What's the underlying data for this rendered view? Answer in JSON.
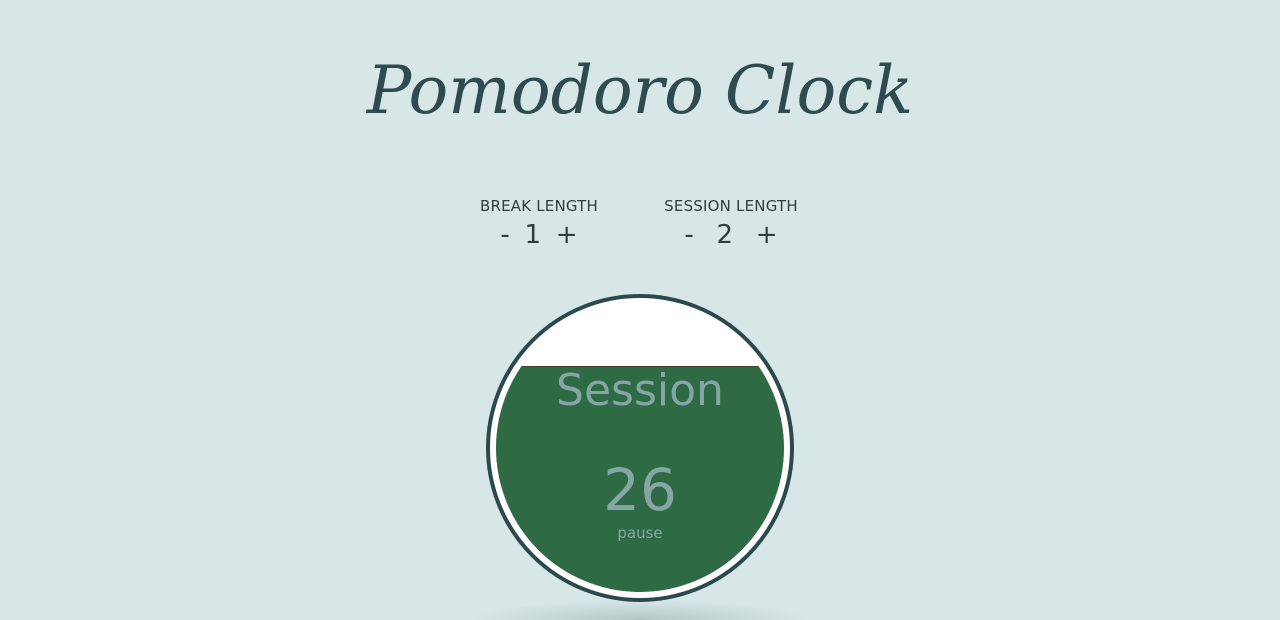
{
  "app": {
    "title": "Pomodoro Clock"
  },
  "break_length": {
    "label": "BREAK LENGTH",
    "decrement": "-",
    "value": "1",
    "increment": "+"
  },
  "session_length": {
    "label": "SESSION LENGTH",
    "decrement": "-",
    "value": "2",
    "increment": "+"
  },
  "clock": {
    "mode_label": "Session",
    "time": "26",
    "status": "pause",
    "fill_fraction": 0.78,
    "fill_color": "#2e6b44",
    "ring_color": "#2c4a4d",
    "text_color": "#86a6a6"
  },
  "colors": {
    "background": "#d7e7e7",
    "title": "#2e4b4f"
  }
}
